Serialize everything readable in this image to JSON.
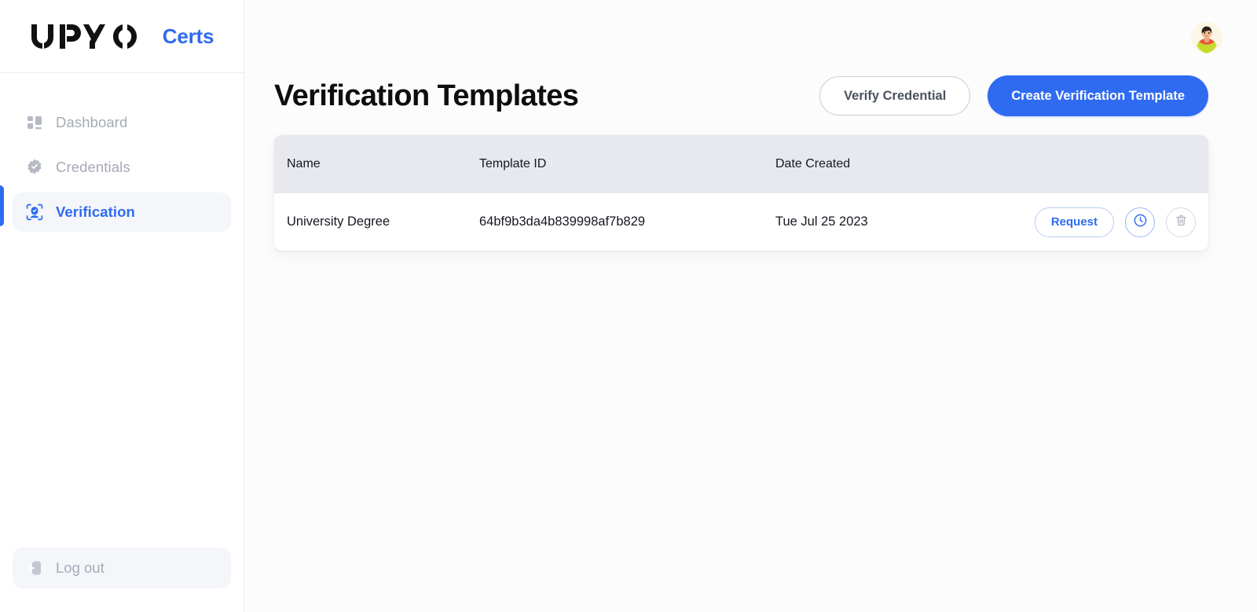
{
  "brand": {
    "logo_text": "UPYO",
    "suffix": "Certs",
    "accent_color": "#2f6bf0"
  },
  "sidebar": {
    "items": [
      {
        "label": "Dashboard",
        "icon": "grid-icon",
        "active": false
      },
      {
        "label": "Credentials",
        "icon": "badge-check-icon",
        "active": false
      },
      {
        "label": "Verification",
        "icon": "face-scan-icon",
        "active": true
      }
    ],
    "logout": {
      "label": "Log out",
      "icon": "logout-icon"
    }
  },
  "topbar": {
    "avatar_alt": "user-avatar"
  },
  "page": {
    "title": "Verification Templates",
    "actions": {
      "verify_label": "Verify Credential",
      "create_label": "Create Verification Template"
    }
  },
  "table": {
    "columns": [
      "Name",
      "Template ID",
      "Date Created"
    ],
    "rows": [
      {
        "name": "University Degree",
        "template_id": "64bf9b3da4b839998af7b829",
        "date_created": "Tue Jul 25 2023",
        "actions": {
          "request_label": "Request",
          "history_icon": "clock-icon",
          "delete_icon": "trash-icon"
        }
      }
    ]
  },
  "colors": {
    "primary": "#2f6bf0",
    "sidebar_muted": "#a6aab6",
    "table_header_bg": "#e7e9ee",
    "page_bg": "#fcfcfd"
  }
}
